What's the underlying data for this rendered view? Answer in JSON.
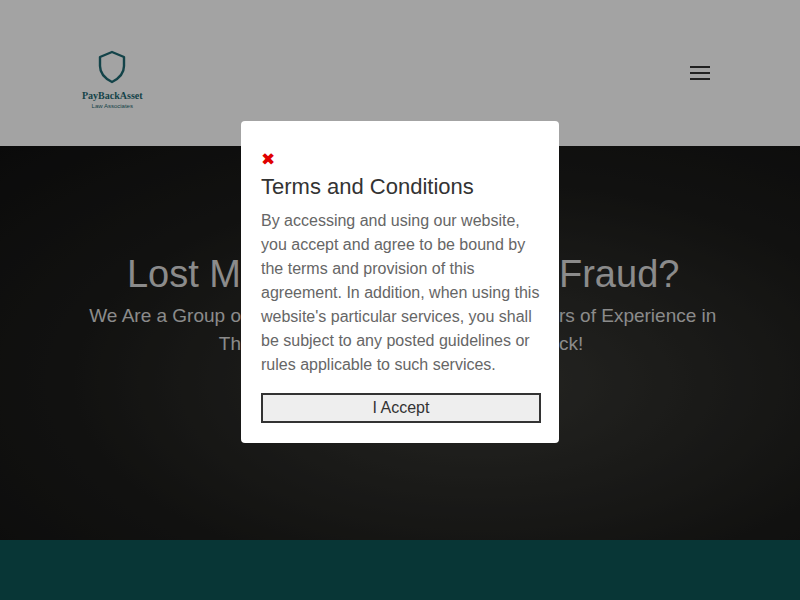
{
  "header": {
    "logo": {
      "name": "PayBackAsset",
      "tagline": "Law Associates"
    }
  },
  "hero": {
    "title": [
      "Lost M",
      "Fraud?"
    ],
    "subtitle_lines": [
      [
        "We Are a Group o",
        "rs of Experience in"
      ],
      [
        "Th",
        "ck!"
      ]
    ]
  },
  "modal": {
    "close": "✖",
    "title": "Terms and Conditions",
    "body": "By accessing and using our website, you accept and agree to be bound by the terms and provision of this agreement. In addition, when using this website's particular services, you shall be subject to any posted guidelines or rules applicable to such services.",
    "button": "I Accept"
  }
}
